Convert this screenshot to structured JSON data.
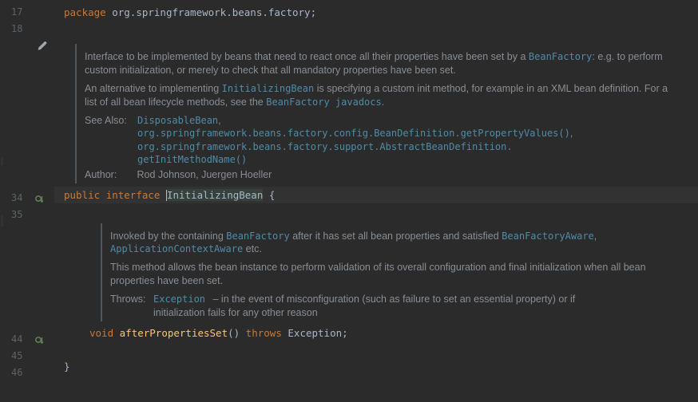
{
  "lines": {
    "l17": "17",
    "l18": "18",
    "l34": "34",
    "l35": "35",
    "l44": "44",
    "l45": "45",
    "l46": "46"
  },
  "code": {
    "package_kw": "package",
    "package_path": "org.springframework.beans.factory",
    "semicolon": ";",
    "public_kw": "public",
    "interface_kw": "interface",
    "iface_name": "InitializingBean",
    "open_brace": "{",
    "void_kw": "void",
    "method_name": "afterPropertiesSet",
    "parens": "()",
    "throws_kw": "throws",
    "exc_name": "Exception",
    "method_end": ";",
    "close_brace": "}"
  },
  "doc1": {
    "p1a": "Interface to be implemented by beans that need to react once all their properties have been set by a ",
    "bean_factory": "BeanFactory",
    "p1b": ": e.g. to perform custom initialization, or merely to check that all mandatory properties have been set.",
    "p2a": "An alternative to implementing ",
    "init_bean": "InitializingBean",
    "p2b": " is specifying a custom init method, for example in an XML bean definition. For a list of all bean lifecycle methods, see the ",
    "bf_javadocs": "BeanFactory javadocs",
    "p2c": ".",
    "see_label": "See Also:",
    "see1": "DisposableBean",
    "see1_comma": ",",
    "see2": "org.springframework.beans.factory.config.BeanDefinition.getPropertyValues()",
    "see2_comma": ",",
    "see3a": "org.springframework.beans.factory.support.AbstractBeanDefinition.",
    "see3b": "getInitMethodName()",
    "author_label": "Author:",
    "author_val": "Rod Johnson, Juergen Hoeller"
  },
  "doc2": {
    "p1a": "Invoked by the containing ",
    "bean_factory": "BeanFactory",
    "p1b": " after it has set all bean properties and satisfied ",
    "bfa": "BeanFactoryAware",
    "p1c": ", ",
    "aca": "ApplicationContextAware",
    "p1d": " etc.",
    "p2": "This method allows the bean instance to perform validation of its overall configuration and final initialization when all bean properties have been set.",
    "throws_label": "Throws:",
    "throws_exc": "Exception",
    "throws_desc": " – in the event of misconfiguration (such as failure to set an essential property) or if initialization fails for any other reason"
  }
}
